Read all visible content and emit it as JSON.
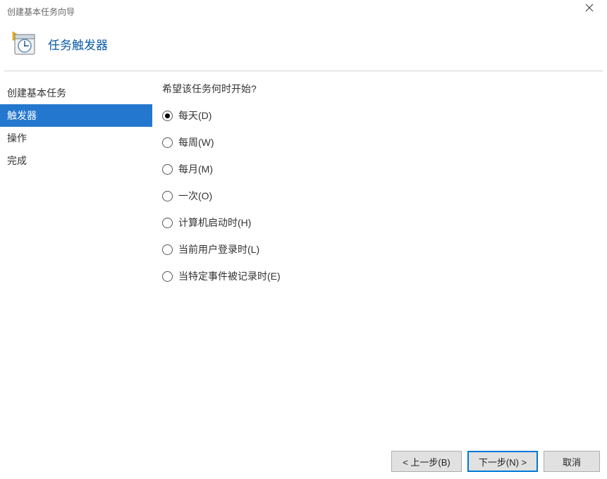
{
  "window": {
    "title": "创建基本任务向导"
  },
  "header": {
    "title": "任务触发器"
  },
  "sidebar": {
    "items": [
      {
        "label": "创建基本任务",
        "selected": false
      },
      {
        "label": "触发器",
        "selected": true
      },
      {
        "label": "操作",
        "selected": false
      },
      {
        "label": "完成",
        "selected": false
      }
    ]
  },
  "content": {
    "question": "希望该任务何时开始?",
    "options": [
      {
        "label": "每天(D)",
        "checked": true
      },
      {
        "label": "每周(W)",
        "checked": false
      },
      {
        "label": "每月(M)",
        "checked": false
      },
      {
        "label": "一次(O)",
        "checked": false
      },
      {
        "label": "计算机启动时(H)",
        "checked": false
      },
      {
        "label": "当前用户登录时(L)",
        "checked": false
      },
      {
        "label": "当特定事件被记录时(E)",
        "checked": false
      }
    ]
  },
  "footer": {
    "back": "< 上一步(B)",
    "next": "下一步(N) >",
    "cancel": "取消"
  }
}
